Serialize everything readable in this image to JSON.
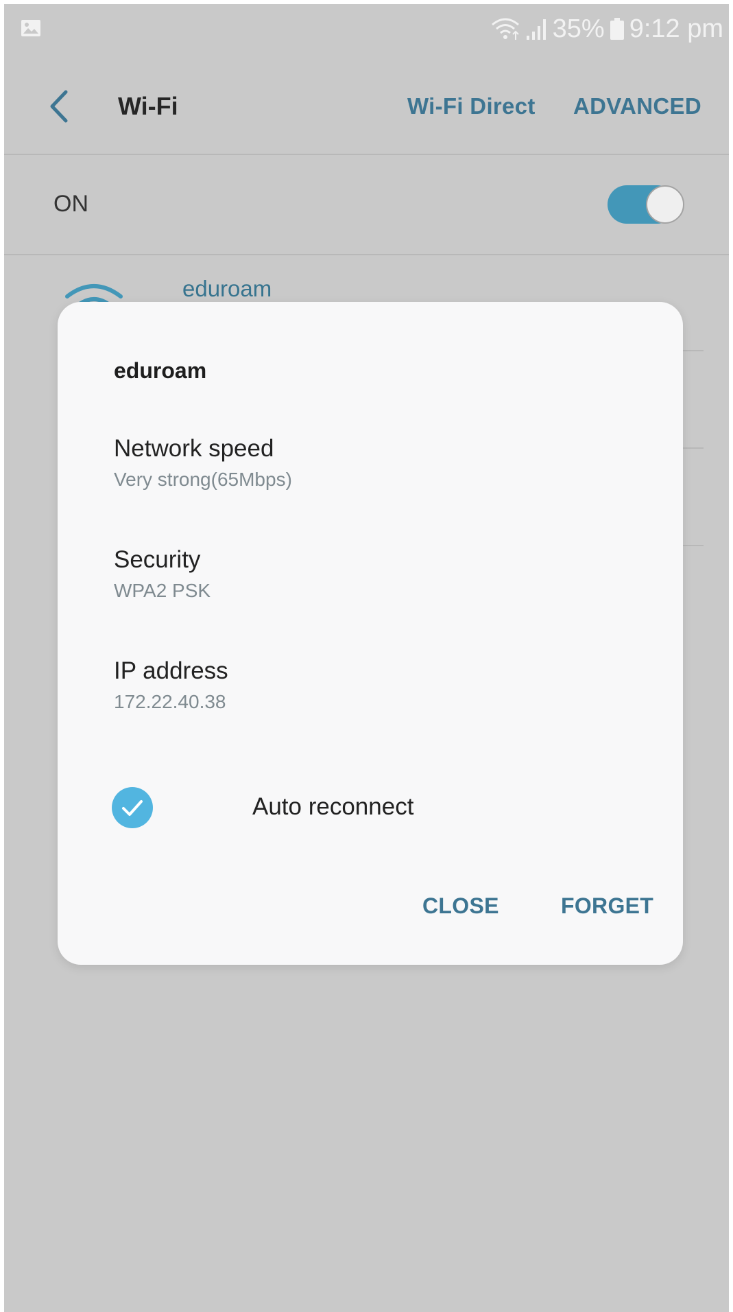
{
  "status_bar": {
    "battery": "35%",
    "time": "9:12 pm",
    "icons": [
      "gallery-icon",
      "wifi-status-icon",
      "signal-icon",
      "battery-icon"
    ]
  },
  "app_bar": {
    "title": "Wi-Fi",
    "wifi_direct": "Wi-Fi Direct",
    "advanced": "ADVANCED"
  },
  "wifi_toggle": {
    "label": "ON",
    "on": true
  },
  "networks": [
    {
      "name": "eduroam"
    }
  ],
  "dialog": {
    "title": "eduroam",
    "network_speed_label": "Network speed",
    "network_speed_value": "Very strong(65Mbps)",
    "security_label": "Security",
    "security_value": "WPA2 PSK",
    "ip_label": "IP address",
    "ip_value": "172.22.40.38",
    "auto_reconnect_label": "Auto reconnect",
    "auto_reconnect_checked": true,
    "close_label": "CLOSE",
    "forget_label": "FORGET"
  },
  "colors": {
    "accent": "#3d7592",
    "toggle_on": "#4397b8",
    "checkbox": "#52b5e0",
    "scrim_background": "#c9c9c9",
    "dialog_background": "#f8f8f9"
  }
}
